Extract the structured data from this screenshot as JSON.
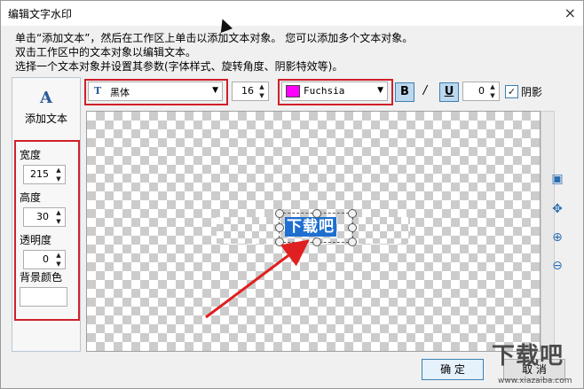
{
  "window": {
    "title": "编辑文字水印",
    "close_label": "×"
  },
  "instructions": [
    "单击“添加文本”，然后在工作区上单击以添加文本对象。 您可以添加多个文本对象。",
    "双击工作区中的文本对象以编辑文本。",
    "选择一个文本对象并设置其参数(字体样式、旋转角度、阴影特效等)。"
  ],
  "left_panel": {
    "add_text_icon": "A",
    "add_text_label": "添加文本",
    "width_label": "宽度",
    "width_value": "215",
    "height_label": "高度",
    "height_value": "30",
    "opacity_label": "透明度",
    "opacity_value": "0",
    "bg_color_label": "背景颜色"
  },
  "toolbar": {
    "font_icon": "T",
    "font_name": "黑体",
    "font_size": "16",
    "color_name": "Fuchsia",
    "color_hex": "#ff00ff",
    "bold_label": "B",
    "italic_label": "/",
    "underline_label": "U",
    "rotation_value": "0",
    "shadow_checked": true,
    "shadow_label": "阴影"
  },
  "canvas": {
    "watermark_text": "下载吧"
  },
  "side_tools": {
    "fit_icon": "fit-icon",
    "move_icon": "move-icon",
    "zoom_in_icon": "zoom-in-icon",
    "zoom_out_icon": "zoom-out-icon"
  },
  "buttons": {
    "ok_label": "确 定",
    "cancel_label": "取 消"
  },
  "site_watermark": {
    "logo": "下载吧",
    "url": "www.xiazaiba.com"
  }
}
